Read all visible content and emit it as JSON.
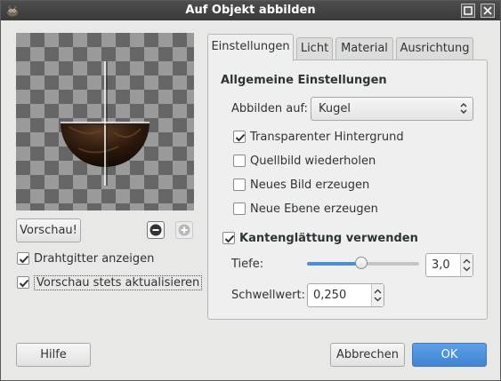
{
  "window": {
    "title": "Auf Objekt abbilden"
  },
  "left": {
    "preview_button": "Vorschau!",
    "wireframe_label": "Drahtgitter anzeigen",
    "wireframe_checked": true,
    "auto_preview_label": "Vorschau stets aktualisieren",
    "auto_preview_checked": true
  },
  "tabs": [
    {
      "label": "Einstellungen",
      "active": true
    },
    {
      "label": "Licht",
      "active": false
    },
    {
      "label": "Material",
      "active": false
    },
    {
      "label": "Ausrichtung",
      "active": false
    }
  ],
  "settings": {
    "general_title": "Allgemeine Einstellungen",
    "map_to_label": "Abbilden auf:",
    "map_to_value": "Kugel",
    "options": [
      {
        "label": "Transparenter Hintergrund",
        "checked": true
      },
      {
        "label": "Quellbild wiederholen",
        "checked": false
      },
      {
        "label": "Neues Bild erzeugen",
        "checked": false
      },
      {
        "label": "Neue Ebene erzeugen",
        "checked": false
      }
    ],
    "antialias_label": "Kantenglättung verwenden",
    "antialias_checked": true,
    "depth_label": "Tiefe:",
    "depth_value": "3,0",
    "depth_slider_fraction": 0.48,
    "threshold_label": "Schwellwert:",
    "threshold_value": "0,250"
  },
  "buttons": {
    "help": "Hilfe",
    "cancel": "Abbrechen",
    "ok": "OK"
  },
  "colors": {
    "accent": "#4a90d9",
    "ok_button": "#4a8fdc",
    "titlebar": "#444444"
  }
}
